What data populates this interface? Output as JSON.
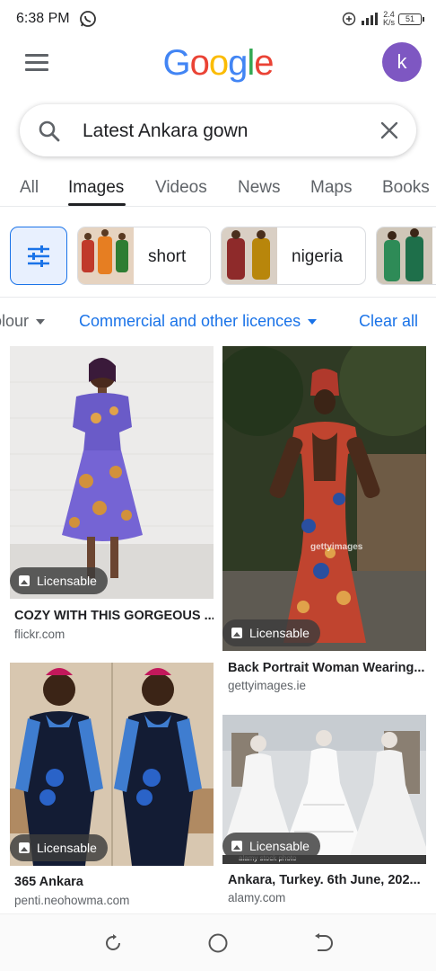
{
  "status_bar": {
    "time": "6:38 PM",
    "speed_value": "2.4",
    "speed_unit": "K/s",
    "battery": "51",
    "icons": [
      "whatsapp-icon",
      "alarm-icon",
      "signal-icon",
      "battery-icon"
    ]
  },
  "header": {
    "logo_letters": [
      "G",
      "o",
      "o",
      "g",
      "l",
      "e"
    ],
    "logo_colors": [
      "#4285F4",
      "#EA4335",
      "#FBBC05",
      "#4285F4",
      "#34A853",
      "#EA4335"
    ],
    "avatar_initial": "k",
    "avatar_color": "#7E57C2"
  },
  "search": {
    "query": "Latest Ankara gown"
  },
  "tabs": [
    {
      "label": "All",
      "active": false
    },
    {
      "label": "Images",
      "active": true
    },
    {
      "label": "Videos",
      "active": false
    },
    {
      "label": "News",
      "active": false
    },
    {
      "label": "Maps",
      "active": false
    },
    {
      "label": "Books",
      "active": false
    }
  ],
  "chips": [
    {
      "label": "short"
    },
    {
      "label": "nigeria"
    },
    {
      "label": ""
    }
  ],
  "filters": {
    "colour": "olour",
    "licence": "Commercial and other licences",
    "clear": "Clear all"
  },
  "results": [
    {
      "title": "COZY WITH THIS GORGEOUS ...",
      "source": "flickr.com",
      "badge": "Licensable"
    },
    {
      "title": "Back Portrait Woman Wearing...",
      "source": "gettyimages.ie",
      "badge": "Licensable",
      "watermark": "gettyimages"
    },
    {
      "title": "365 Ankara",
      "source": "penti.neohowma.com",
      "badge": "Licensable"
    },
    {
      "title": "Ankara, Turkey. 6th June, 202...",
      "source": "alamy.com",
      "badge": "Licensable",
      "watermark": "alamy stock photo"
    }
  ],
  "accent_color": "#1A73E8"
}
